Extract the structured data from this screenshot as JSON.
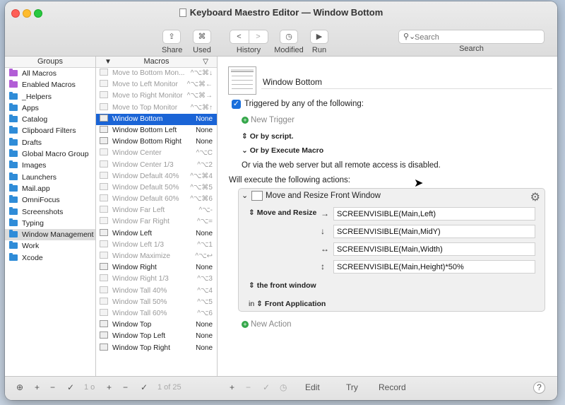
{
  "window": {
    "title": "Keyboard Maestro Editor — Window Bottom"
  },
  "toolbar": {
    "share": "Share",
    "used": "Used",
    "history": "History",
    "modified": "Modified",
    "run": "Run",
    "search_placeholder": "Search",
    "search_label": "Search"
  },
  "groups": {
    "header": "Groups",
    "items": [
      {
        "label": "All Macros",
        "smart": true
      },
      {
        "label": "Enabled Macros",
        "smart": true
      },
      {
        "label": "_Helpers",
        "smart": false
      },
      {
        "label": "Apps",
        "smart": false
      },
      {
        "label": "Catalog",
        "smart": false
      },
      {
        "label": "Clipboard Filters",
        "smart": false
      },
      {
        "label": "Drafts",
        "smart": false
      },
      {
        "label": "Global Macro Group",
        "smart": false
      },
      {
        "label": "Images",
        "smart": false
      },
      {
        "label": "Launchers",
        "smart": false
      },
      {
        "label": "Mail.app",
        "smart": false
      },
      {
        "label": "OmniFocus",
        "smart": false
      },
      {
        "label": "Screenshots",
        "smart": false
      },
      {
        "label": "Typing",
        "smart": false
      },
      {
        "label": "Window Management",
        "smart": false,
        "selected": true
      },
      {
        "label": "Work",
        "smart": false
      },
      {
        "label": "Xcode",
        "smart": false
      }
    ]
  },
  "macros": {
    "header": "Macros",
    "items": [
      {
        "label": "Move to Bottom Mon...",
        "hotkey": "^⌥⌘↓",
        "dim": true
      },
      {
        "label": "Move to Left Monitor",
        "hotkey": "^⌥⌘←",
        "dim": true
      },
      {
        "label": "Move to Right Monitor",
        "hotkey": "^⌥⌘→",
        "dim": true
      },
      {
        "label": "Move to Top Monitor",
        "hotkey": "^⌥⌘↑",
        "dim": true
      },
      {
        "label": "Window Bottom",
        "hotkey": "None",
        "dim": false,
        "selected": true
      },
      {
        "label": "Window Bottom Left",
        "hotkey": "None",
        "dim": false
      },
      {
        "label": "Window Bottom Right",
        "hotkey": "None",
        "dim": false
      },
      {
        "label": "Window Center",
        "hotkey": "^⌥C",
        "dim": true
      },
      {
        "label": "Window Center 1/3",
        "hotkey": "^⌥2",
        "dim": true
      },
      {
        "label": "Window Default 40%",
        "hotkey": "^⌥⌘4",
        "dim": true
      },
      {
        "label": "Window Default 50%",
        "hotkey": "^⌥⌘5",
        "dim": true
      },
      {
        "label": "Window Default 60%",
        "hotkey": "^⌥⌘6",
        "dim": true
      },
      {
        "label": "Window Far Left",
        "hotkey": "^⌥-",
        "dim": true
      },
      {
        "label": "Window Far Right",
        "hotkey": "^⌥=",
        "dim": true
      },
      {
        "label": "Window Left",
        "hotkey": "None",
        "dim": false
      },
      {
        "label": "Window Left 1/3",
        "hotkey": "^⌥1",
        "dim": true
      },
      {
        "label": "Window Maximize",
        "hotkey": "^⌥↩",
        "dim": true
      },
      {
        "label": "Window Right",
        "hotkey": "None",
        "dim": false
      },
      {
        "label": "Window Right 1/3",
        "hotkey": "^⌥3",
        "dim": true
      },
      {
        "label": "Window Tall 40%",
        "hotkey": "^⌥4",
        "dim": true
      },
      {
        "label": "Window Tall 50%",
        "hotkey": "^⌥5",
        "dim": true
      },
      {
        "label": "Window Tall 60%",
        "hotkey": "^⌥6",
        "dim": true
      },
      {
        "label": "Window Top",
        "hotkey": "None",
        "dim": false
      },
      {
        "label": "Window Top Left",
        "hotkey": "None",
        "dim": false
      },
      {
        "label": "Window Top Right",
        "hotkey": "None",
        "dim": false
      }
    ]
  },
  "editor": {
    "macro_name": "Window Bottom",
    "triggered_label": "Triggered by any of the following:",
    "new_trigger": "New Trigger",
    "or_script": "Or by script.",
    "or_execute": "Or by Execute Macro",
    "web_server": "Or via the web server but all remote access is disabled.",
    "will_execute": "Will execute the following actions:",
    "action_title": "Move and Resize Front Window",
    "move_resize": "Move and Resize",
    "fields": [
      {
        "arrow": "→",
        "value": "SCREENVISIBLE(Main,Left)"
      },
      {
        "arrow": "↓",
        "value": "SCREENVISIBLE(Main,MidY)"
      },
      {
        "arrow": "↔",
        "value": "SCREENVISIBLE(Main,Width)"
      },
      {
        "arrow": "↕",
        "value": "SCREENVISIBLE(Main,Height)*50%"
      }
    ],
    "front_window": "the front window",
    "in_label": "in",
    "front_app": "Front Application",
    "new_action": "New Action"
  },
  "bottombar": {
    "groups_count": "1 o",
    "macros_count": "1 of 25",
    "edit": "Edit",
    "try": "Try",
    "record": "Record",
    "help": "?"
  }
}
